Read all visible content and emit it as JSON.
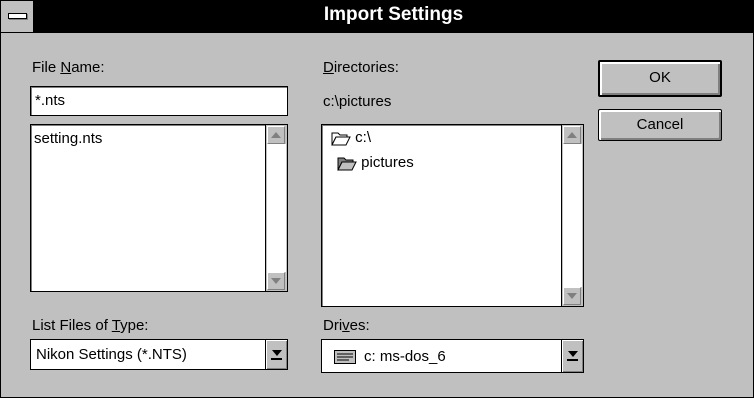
{
  "window": {
    "title": "Import Settings"
  },
  "file_name": {
    "label_pre": "File ",
    "label_accel": "N",
    "label_post": "ame:",
    "value": "*.nts"
  },
  "files_list": {
    "items": [
      "setting.nts"
    ]
  },
  "directories": {
    "label_accel": "D",
    "label_post": "irectories:",
    "current_path": "c:\\pictures",
    "items": [
      {
        "label": "c:\\",
        "icon": "open-folder-icon"
      },
      {
        "label": "pictures",
        "icon": "open-folder-icon"
      }
    ]
  },
  "file_type": {
    "label_pre": "List Files of ",
    "label_accel": "T",
    "label_post": "ype:",
    "selected": "Nikon Settings (*.NTS)"
  },
  "drives": {
    "label_pre": "Dri",
    "label_accel": "v",
    "label_post": "es:",
    "selected": "c: ms-dos_6",
    "icon": "hard-drive-icon"
  },
  "buttons": {
    "ok": "OK",
    "cancel": "Cancel"
  }
}
